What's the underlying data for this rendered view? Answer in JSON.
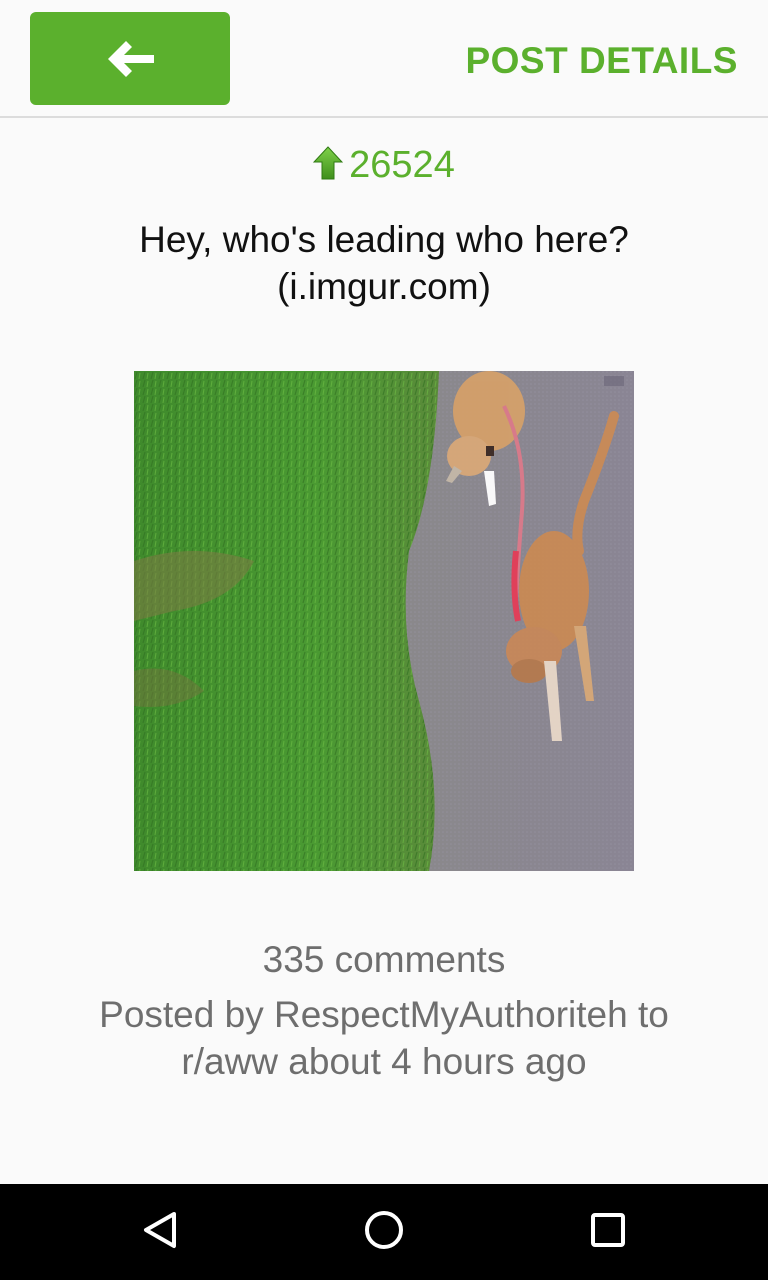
{
  "toolbar": {
    "back_icon": "arrow-left-icon",
    "title": "POST DETAILS"
  },
  "post": {
    "score_icon": "upvote-arrow-icon",
    "score": "26524",
    "title": "Hey, who's leading who here? (i.imgur.com)",
    "image_description_icon": "cats-on-leash-photo",
    "comments": "335 comments",
    "meta": "Posted by RespectMyAuthoriteh to r/aww about 4 hours ago"
  },
  "nav": {
    "back_icon": "nav-back-triangle-icon",
    "home_icon": "nav-home-circle-icon",
    "recents_icon": "nav-recents-square-icon"
  },
  "colors": {
    "accent": "#5bb02d",
    "secondary_text": "#6e6e6e",
    "background": "#fafafa"
  }
}
